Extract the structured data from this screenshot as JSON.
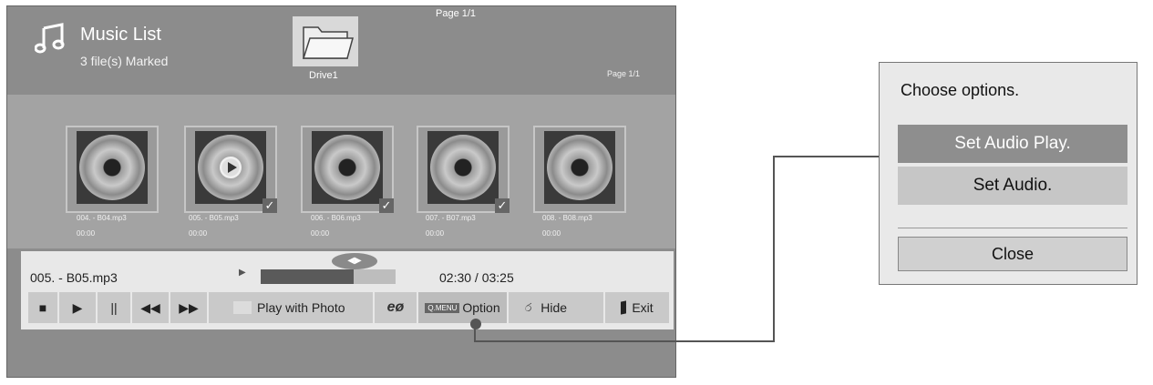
{
  "header": {
    "title": "Music List",
    "marked": "3 file(s) Marked",
    "page_top": "Page 1/1",
    "drive_label": "Drive1",
    "page_right": "Page 1/1"
  },
  "thumbnails": [
    {
      "name": "004. - B04.mp3",
      "time": "00:00",
      "checked": false,
      "playing": false
    },
    {
      "name": "005. - B05.mp3",
      "time": "00:00",
      "checked": true,
      "playing": true
    },
    {
      "name": "006. - B06.mp3",
      "time": "00:00",
      "checked": true,
      "playing": false
    },
    {
      "name": "007. - B07.mp3",
      "time": "00:00",
      "checked": true,
      "playing": false
    },
    {
      "name": "008. - B08.mp3",
      "time": "00:00",
      "checked": false,
      "playing": false
    }
  ],
  "player": {
    "track": "005. - B05.mp3",
    "time": "02:30 / 03:25",
    "progress_fraction": 0.69
  },
  "controls": {
    "stop": "■",
    "play": "▶",
    "pause": "||",
    "rewind": "◀◀",
    "forward": "▶▶",
    "play_with_photo": "Play with Photo",
    "eco": "eø",
    "qmenu_key": "Q.MENU",
    "option": "Option",
    "hide": "Hide",
    "exit": "Exit"
  },
  "dialog": {
    "title": "Choose options.",
    "options": [
      "Set Audio Play.",
      "Set Audio."
    ],
    "close": "Close"
  },
  "icons": {
    "music": "music-note-icon",
    "folder": "folder-icon",
    "hide": "hide-icon",
    "exit": "exit-door-icon"
  },
  "colors": {
    "screen_bg": "#8c8c8c",
    "panel_bg": "#e8e8e8",
    "selected_option": "#8e8e8e"
  }
}
